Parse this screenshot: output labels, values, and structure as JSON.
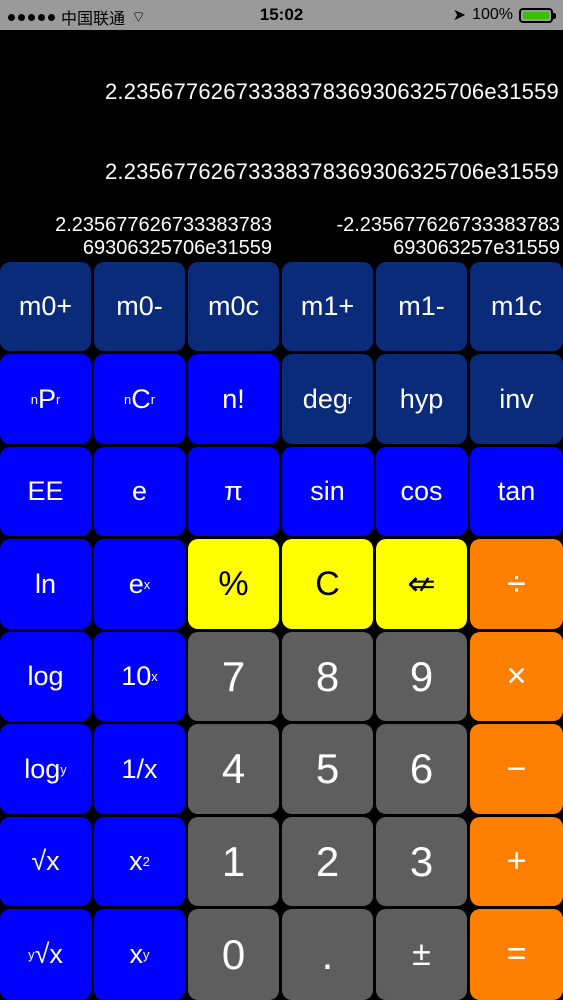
{
  "status_bar": {
    "carrier": "中国联通",
    "time": "15:02",
    "battery": "100%"
  },
  "display": {
    "line1": "2.2356776267333837836930632570​6e31559",
    "line2": "2.23567762673338378369306325706e31559",
    "left_line1": "2.235677626733383783",
    "left_line2": "69306325706e31559",
    "right_line1": "-2.235677626733383783",
    "right_line2": "693063257e31559"
  },
  "keys": {
    "m0plus": "m0+",
    "m0minus": "m0-",
    "m0c": "m0c",
    "m1plus": "m1+",
    "m1minus": "m1-",
    "m1c": "m1c",
    "npr_sub": "n",
    "npr_main": "P",
    "npr_sub2": "r",
    "ncr_sub": "n",
    "ncr_main": "C",
    "ncr_sub2": "r",
    "fact": "n!",
    "deg_main": "deg",
    "deg_sub": "r",
    "hyp": "hyp",
    "inv": "inv",
    "ee": "EE",
    "e": "e",
    "pi": "π",
    "sin": "sin",
    "cos": "cos",
    "tan": "tan",
    "ln": "ln",
    "ex_main": "e",
    "ex_sup": "x",
    "percent": "%",
    "clear": "C",
    "back": "⇍",
    "divide": "÷",
    "log": "log",
    "tenx_main": "10",
    "tenx_sup": "x",
    "seven": "7",
    "eight": "8",
    "nine": "9",
    "multiply": "×",
    "logy_main": "log",
    "logy_sub": "y",
    "recip": "1/x",
    "four": "4",
    "five": "5",
    "six": "6",
    "minus": "−",
    "sqrt": "√x",
    "sq_main": "x",
    "sq_sup": "2",
    "one": "1",
    "two": "2",
    "three": "3",
    "plus": "+",
    "yroot_sup": "y",
    "yroot_main": "√x",
    "pow_main": "x",
    "pow_sup": "y",
    "zero": "0",
    "dot": ".",
    "plusminus": "±",
    "equals": "="
  }
}
